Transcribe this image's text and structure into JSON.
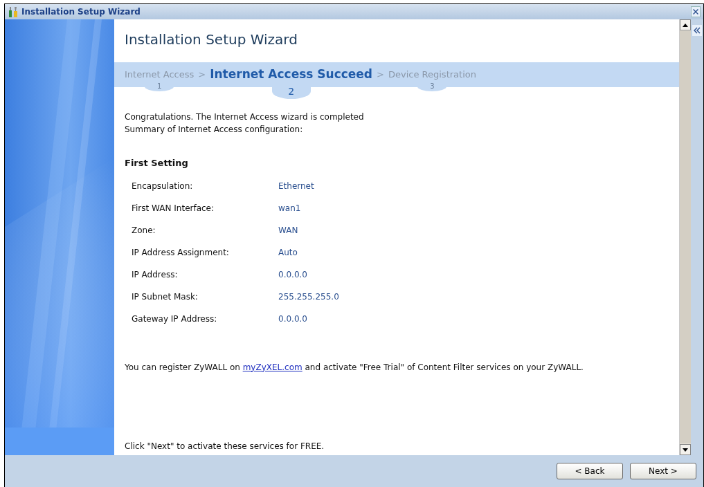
{
  "window": {
    "title": "Installation Setup Wizard"
  },
  "heading": "Installation Setup Wizard",
  "steps": [
    {
      "label": "Internet Access",
      "number": "1",
      "selected": false
    },
    {
      "separator": ">",
      "label": "Internet Access Succeed",
      "number": "2",
      "selected": true
    },
    {
      "separator": ">",
      "label": "Device Registration",
      "number": "3",
      "selected": false
    }
  ],
  "intro": [
    "Congratulations. The Internet Access wizard is completed",
    "Summary of Internet Access configuration:"
  ],
  "section_title": "First Setting",
  "settings": [
    {
      "label": "Encapsulation:",
      "value": "Ethernet"
    },
    {
      "label": "First WAN Interface:",
      "value": "wan1"
    },
    {
      "label": "Zone:",
      "value": "WAN"
    },
    {
      "label": "IP Address Assignment:",
      "value": "Auto"
    },
    {
      "label": "IP Address:",
      "value": "0.0.0.0"
    },
    {
      "label": "IP Subnet Mask:",
      "value": "255.255.255.0"
    },
    {
      "label": "Gateway IP Address:",
      "value": "0.0.0.0"
    }
  ],
  "register_note": {
    "before": "You can register ZyWALL on",
    "link": "myZyXEL.com",
    "after": "and activate \"Free Trial\" of Content Filter services on your ZyWALL."
  },
  "next_note": "Click \"Next\" to activate these services for FREE.",
  "buttons": [
    "< Back",
    "Next >"
  ]
}
